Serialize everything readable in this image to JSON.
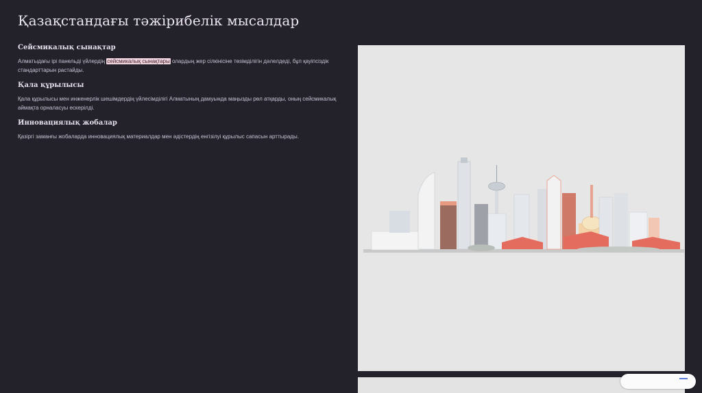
{
  "slide": {
    "title": "Қазақстандағы тәжірибелік мысалдар"
  },
  "sections": [
    {
      "heading": "Сейсмикалық сынақтар",
      "text_before": "Алматыдағы ірі панельді үйлердің ",
      "highlight": "сейсмикалық сынақтары",
      "text_after": " олардың жер сілкінісіне төзімділігін дәлелдеді, бұл қауіпсіздік стандарттарын растайды."
    },
    {
      "heading": "Қала құрылысы",
      "text": "Қала құрылысы мен инженерлік шешімдердің үйлесімділігі Алматының дамуында маңызды рөл атқарды, оның сейсмикалық аймақта орналасуы ескерілді."
    },
    {
      "heading": "Инновациялық жобалар",
      "text": "Қазіргі заманғы жобаларда инновациялық материалдар мен әдістердің енгізілуі құрылыс сапасын арттырады."
    }
  ],
  "colors": {
    "background": "#23222a",
    "highlight": "#f2d6df",
    "image_bg": "#e6e6e6"
  },
  "icons": {
    "city_illustration": "city-skyline-illustration"
  }
}
